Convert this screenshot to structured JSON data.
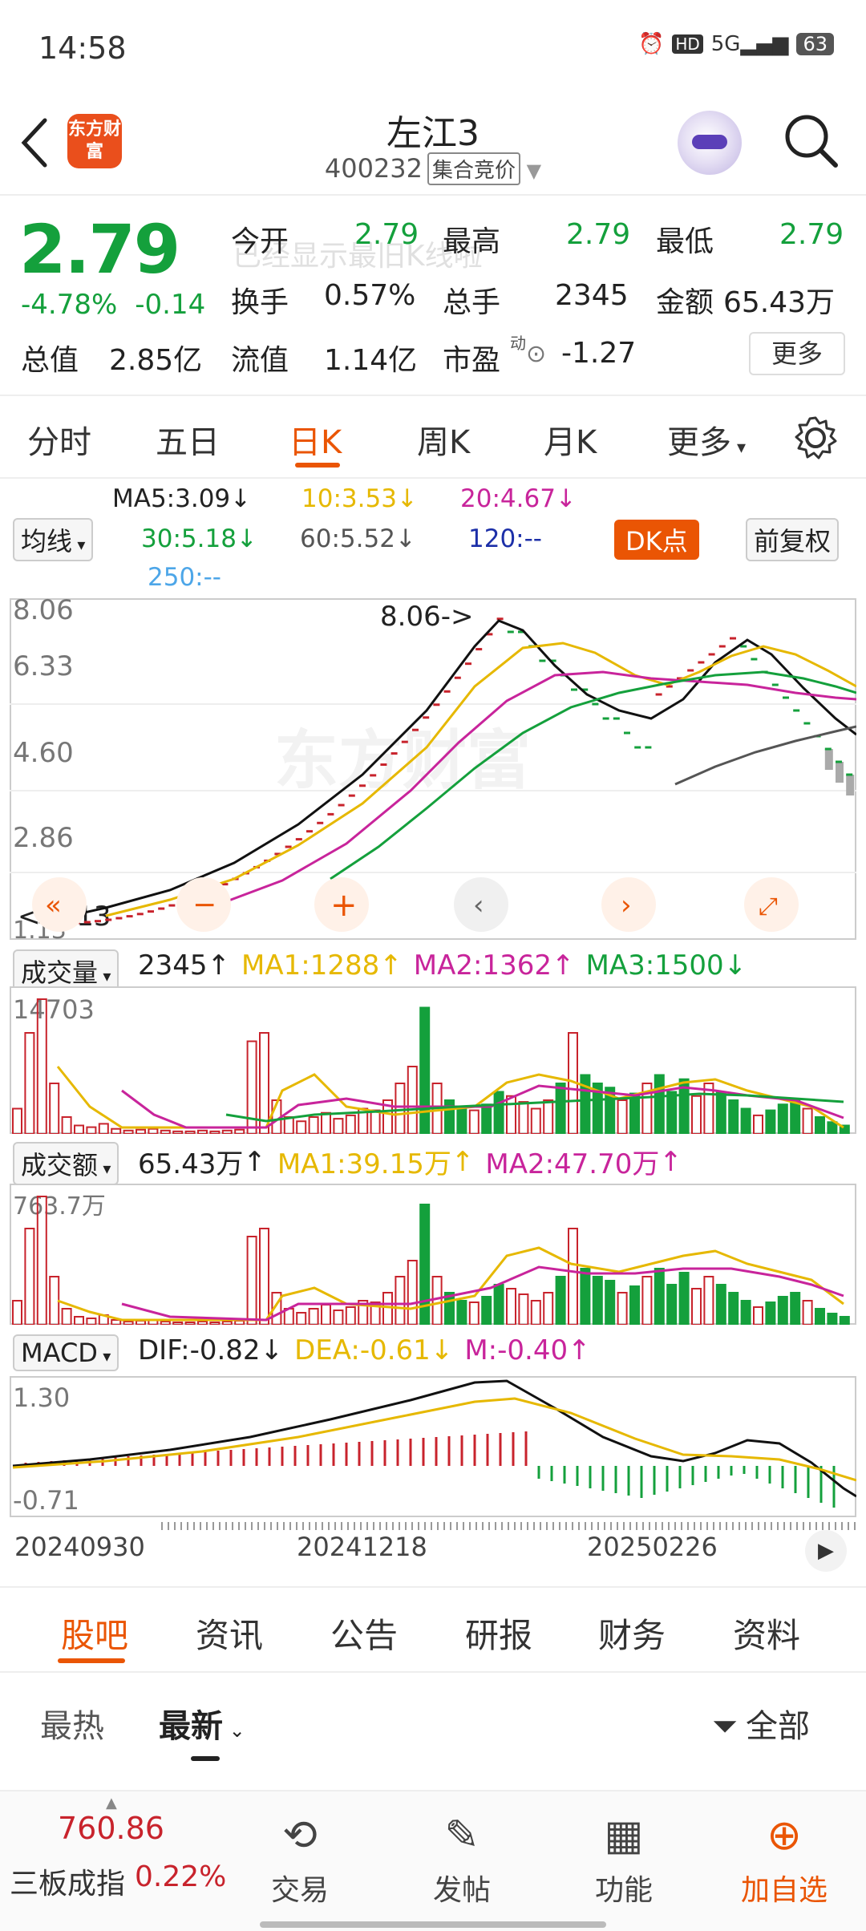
{
  "status_bar": {
    "time": "14:58",
    "battery": "63"
  },
  "header": {
    "logo_text": "东方财富",
    "title": "左江3",
    "code": "400232",
    "tag": "集合竞价"
  },
  "quote": {
    "price": "2.79",
    "change_pct": "-4.78%",
    "change": "-0.14",
    "open_label": "今开",
    "open": "2.79",
    "high_label": "最高",
    "high": "2.79",
    "low_label": "最低",
    "low": "2.79",
    "turnover_label": "换手",
    "turnover": "0.57%",
    "volume_label": "总手",
    "volume": "2345",
    "amount_label": "金额",
    "amount": "65.43万",
    "mktcap_label": "总值",
    "mktcap": "2.85亿",
    "float_label": "流值",
    "float": "1.14亿",
    "pe_label": "市盈",
    "pe_sup": "动",
    "pe": "-1.27",
    "more": "更多",
    "toast": "已经显示最旧K线啦"
  },
  "period_tabs": [
    "分时",
    "五日",
    "日K",
    "周K",
    "月K",
    "更多"
  ],
  "ma_legend": {
    "ma5": "MA5:3.09",
    "ma10": "10:3.53",
    "ma20": "20:4.67",
    "ma30": "30:5.18",
    "ma60": "60:5.52",
    "ma120": "120:--",
    "ma250": "250:--",
    "selector": "均线",
    "dk": "DK点",
    "adjust": "前复权"
  },
  "price_chart": {
    "y_labels": [
      "8.06",
      "6.33",
      "4.60",
      "2.86",
      "1.13"
    ],
    "high_marker": "8.06->",
    "low_marker": "<-1.13",
    "watermark": "东方财富"
  },
  "volume_panel": {
    "selector": "成交量",
    "value": "2345",
    "ma1": "MA1:1288",
    "ma2": "MA2:1362",
    "ma3": "MA3:1500",
    "y_max": "14703"
  },
  "amount_panel": {
    "selector": "成交额",
    "value": "65.43万",
    "ma1": "MA1:39.15万",
    "ma2": "MA2:47.70万",
    "y_max": "763.7万"
  },
  "macd_panel": {
    "selector": "MACD",
    "dif": "DIF:-0.82",
    "dea": "DEA:-0.61",
    "m": "M:-0.40",
    "y_max": "1.30",
    "y_min": "-0.71"
  },
  "x_axis": [
    "20240930",
    "20241218",
    "20250226"
  ],
  "content_tabs": [
    "股吧",
    "资讯",
    "公告",
    "研报",
    "财务",
    "资料"
  ],
  "sub_tabs": {
    "hot": "最热",
    "latest": "最新",
    "filter": "全部"
  },
  "footer": {
    "index_value": "760.86",
    "index_name": "三板成指",
    "index_change": "0.22%",
    "trade": "交易",
    "post": "发帖",
    "functions": "功能",
    "add": "加自选"
  },
  "colors": {
    "up": "#c8232c",
    "down": "#14a03c",
    "accent": "#ea5504",
    "ma_yellow": "#e6b800",
    "ma_magenta": "#c8249b"
  }
}
